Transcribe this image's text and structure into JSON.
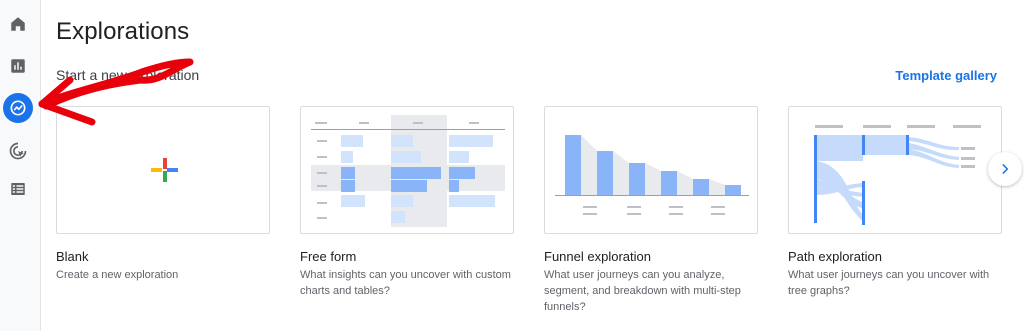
{
  "page": {
    "title": "Explorations",
    "subtitle": "Start a new exploration",
    "template_gallery": "Template gallery"
  },
  "nav": {
    "items": [
      {
        "icon": "home-icon"
      },
      {
        "icon": "reports-icon"
      },
      {
        "icon": "explore-icon",
        "active": true
      },
      {
        "icon": "advertising-icon"
      },
      {
        "icon": "configure-icon"
      }
    ]
  },
  "templates": [
    {
      "title": "Blank",
      "description": "Create a new exploration"
    },
    {
      "title": "Free form",
      "description": "What insights can you uncover with custom charts and tables?"
    },
    {
      "title": "Funnel exploration",
      "description": "What user journeys can you analyze, segment, and breakdown with multi-step funnels?"
    },
    {
      "title": "Path exploration",
      "description": "What user journeys can you uncover with tree graphs?"
    }
  ],
  "colors": {
    "accent": "#1a73e8",
    "annotation": "#e8000b",
    "chart_fill": "#8ab4f8",
    "chart_light": "#d2e3fc"
  }
}
